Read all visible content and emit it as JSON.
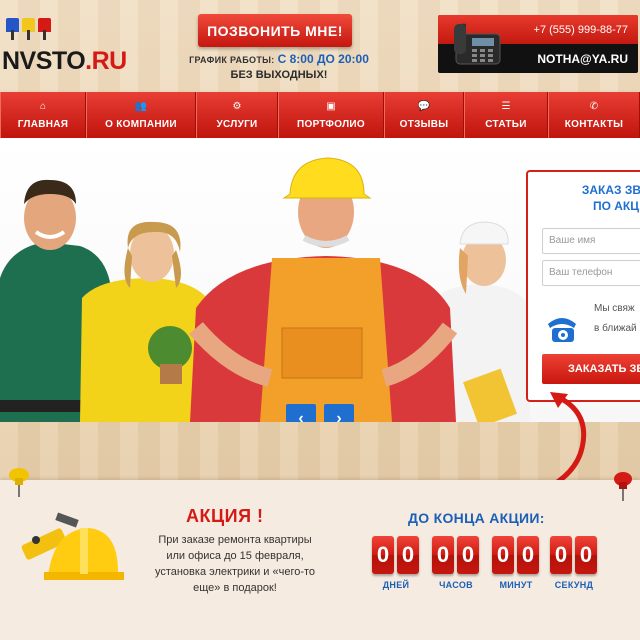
{
  "header": {
    "logo_main": "NVSTO",
    "logo_tld": ".RU",
    "call_button": "ПОЗВОНИТЬ МНЕ!",
    "schedule_label": "ГРАФИК РАБОТЫ:",
    "schedule_time": "С 8:00 ДО 20:00",
    "schedule_days": "БЕЗ ВЫХОДНЫХ!",
    "phone": "+7 (555) 999-88-77",
    "email": "NOTHA@YA.RU"
  },
  "nav": {
    "items": [
      {
        "label": "ГЛАВНАЯ",
        "icon": "home-icon",
        "glyph": "⌂"
      },
      {
        "label": "О КОМПАНИИ",
        "icon": "users-icon",
        "glyph": "👥"
      },
      {
        "label": "УСЛУГИ",
        "icon": "share-icon",
        "glyph": "⚙"
      },
      {
        "label": "ПОРТФОЛИО",
        "icon": "briefcase-icon",
        "glyph": "▣"
      },
      {
        "label": "ОТЗЫВЫ",
        "icon": "comments-icon",
        "glyph": "💬"
      },
      {
        "label": "СТАТЬИ",
        "icon": "list-icon",
        "glyph": "☰"
      },
      {
        "label": "КОНТАКТЫ",
        "icon": "phone-icon",
        "glyph": "✆"
      }
    ]
  },
  "slider": {
    "prev": "‹",
    "next": "›"
  },
  "order_form": {
    "title_line1": "ЗАКАЗ ЗВО",
    "title_line2": "ПО АКЦ",
    "name_placeholder": "Ваше имя",
    "phone_placeholder": "Ваш телефон",
    "note_line1": "Мы свяж",
    "note_line2": "в ближай",
    "submit": "ЗАКАЗАТЬ ЗВ"
  },
  "promo": {
    "title": "АКЦИЯ !",
    "text": "При заказе ремонта квартиры или офиса до 15 февраля, установка электрики и «чего-то еще» в подарок!",
    "countdown_title": "ДО КОНЦА АКЦИИ:",
    "units": [
      {
        "d1": "0",
        "d2": "0",
        "label": "ДНЕЙ"
      },
      {
        "d1": "0",
        "d2": "0",
        "label": "ЧАСОВ"
      },
      {
        "d1": "0",
        "d2": "0",
        "label": "МИНУТ"
      },
      {
        "d1": "0",
        "d2": "0",
        "label": "СЕКУНД"
      }
    ]
  },
  "colors": {
    "brand_red": "#d51a16",
    "accent_blue": "#1c5fb8"
  }
}
